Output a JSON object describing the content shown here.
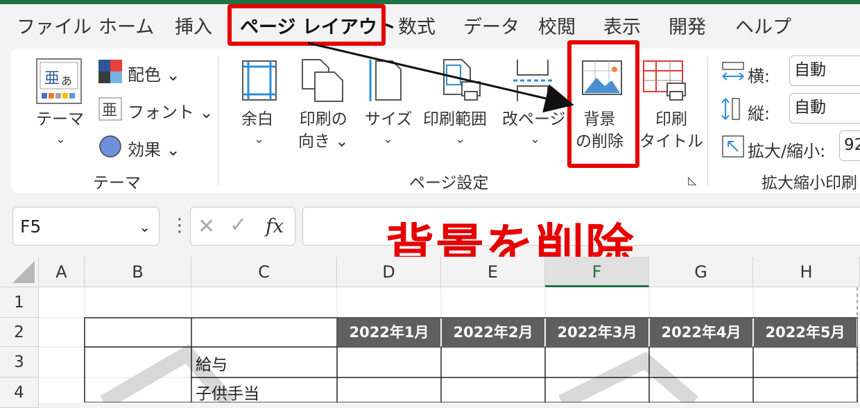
{
  "menu": {
    "tabs": [
      "ファイル",
      "ホーム",
      "挿入",
      "ページ レイアウト",
      "数式",
      "データ",
      "校閲",
      "表示",
      "開発",
      "ヘルプ"
    ],
    "active_tab": "ページ レイアウト"
  },
  "ribbon": {
    "theme_group": {
      "theme_button": "テーマ",
      "colors": "配色",
      "fonts": "フォント",
      "effects": "効果",
      "group_label": "テーマ"
    },
    "page_setup": {
      "margins_line1": "余白",
      "orientation_line1": "印刷の",
      "orientation_line2": "向き",
      "size": "サイズ",
      "print_area": "印刷範囲",
      "breaks": "改ページ",
      "delete_background_line1": "背景",
      "delete_background_line2": "の削除",
      "print_titles_line1": "印刷",
      "print_titles_line2": "タイトル",
      "group_label": "ページ設定"
    },
    "scale_group": {
      "width_label": "横:",
      "width_value": "自動",
      "height_label": "縦:",
      "height_value": "自動",
      "scale_label": "拡大/縮小:",
      "scale_value": "92",
      "group_label": "拡大縮小印刷"
    }
  },
  "formula_bar": {
    "name_box": "F5",
    "fx": "fx"
  },
  "annotation": {
    "title": "背景を削除"
  },
  "sheet": {
    "columns": [
      "A",
      "B",
      "C",
      "D",
      "E",
      "F",
      "G",
      "H"
    ],
    "selected_column": "F",
    "rows": [
      "1",
      "2",
      "3",
      "4"
    ],
    "month_headers": [
      "2022年1月",
      "2022年2月",
      "2022年3月",
      "2022年4月",
      "2022年5月"
    ],
    "row3_c": "給与",
    "row4_c": "子供手当"
  },
  "colors": {
    "accent_red": "#e60000",
    "excel_green": "#1e7145",
    "header_fill": "#5f5f5f"
  }
}
